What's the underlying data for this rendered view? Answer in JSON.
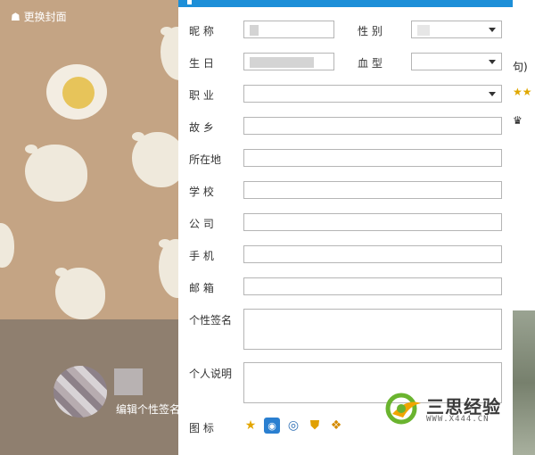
{
  "background": {
    "change_cover": "☗ 更换封面",
    "edit_signature": "编辑个性签名"
  },
  "right_panel": {
    "snippet_1": "句)",
    "snippet_2": "♛"
  },
  "form": {
    "nickname_label": "昵  称",
    "gender_label": "性  别",
    "birthday_label": "生  日",
    "blood_label": "血  型",
    "job_label": "职  业",
    "hometown_label": "故  乡",
    "location_label": "所在地",
    "school_label": "学  校",
    "company_label": "公  司",
    "phone_label": "手  机",
    "email_label": "邮  箱",
    "signature_label": "个性签名",
    "intro_label": "个人说明",
    "icons_label": "图  标"
  },
  "icons": [
    "star-icon",
    "camera-icon",
    "eye-icon",
    "shield-icon",
    "pet-icon"
  ],
  "watermark": {
    "title": "三思经验",
    "url": "WWW.X444.CN"
  }
}
